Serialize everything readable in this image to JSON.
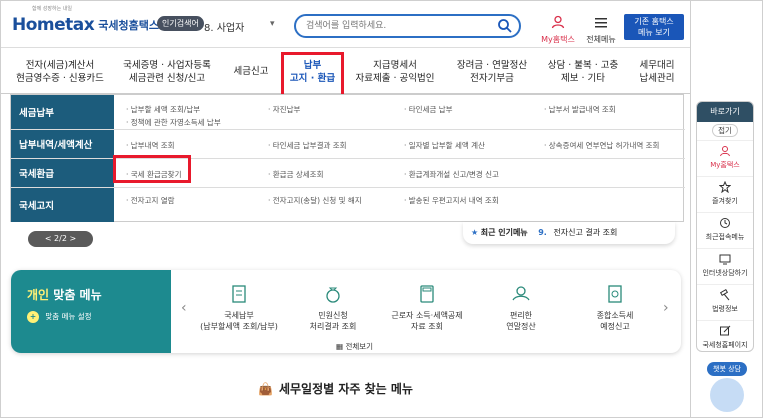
{
  "header": {
    "logo_text": "Hometax",
    "logo_ko": "국세청홈택스",
    "logo_tag": "함께 성장하는 내일",
    "hot_badge": "인기검색어",
    "hot_item": "8. 사업자",
    "search_placeholder": "검색어를 입력하세요.",
    "my_home": "My홈택스",
    "all_menu": "전체메뉴",
    "basic_btn": "기존 홈택스\n메뉴 보기"
  },
  "gnb": {
    "items": [
      "전자(세금)계산서\n현금영수증 · 신용카드",
      "국세증명 · 사업자등록\n세금관련 신청/신고",
      "세금신고",
      "납부\n고지 · 환급",
      "지급명세서\n자료제출 · 공익법인",
      "장려금 · 연말정산\n전자기부금",
      "상담 · 불복 · 고충\n제보 · 기타",
      "세무대리\n납세관리"
    ]
  },
  "dropdown": {
    "rows": [
      {
        "head": "세금납부",
        "links": [
          "납부할 세액 조회/납부",
          "자진납부",
          "타인세금 납부",
          "납부서 발급내역 조회",
          "정책에 관한 자영소득세 납부"
        ]
      },
      {
        "head": "납부내역/세액계산",
        "links": [
          "납부내역 조회",
          "타인세금 납부결과 조회",
          "일자별 납부할 세액 계산",
          "상속증여세 연부연납 허가내역 조회"
        ]
      },
      {
        "head": "국세환급",
        "links": [
          "국세 환급금찾기",
          "환급금 상세조회",
          "환급계좌개설 신고/변경 신고"
        ]
      },
      {
        "head": "국세고지",
        "links": [
          "전자고지 열람",
          "전자고지(송달) 신청 및 해지",
          "발송된 우편고지서 내역 조회"
        ]
      }
    ]
  },
  "banner_ctrl": "< 2/2 >",
  "recent": {
    "title": "최근 인기메뉴",
    "num": "9.",
    "item": "전자신고 결과 조회"
  },
  "personal": {
    "title_a": "개인",
    "title_b": "맞춤 메뉴",
    "setting": "맞춤 메뉴 설정",
    "items": [
      "국세납부\n(납부할세액 조회/납부)",
      "민원신청\n처리결과 조회",
      "근로자 소득·세액공제\n자료 조회",
      "편리한\n연말정산",
      "종합소득세\n예정신고"
    ],
    "view_all": "전체보기"
  },
  "schedule_title": "세무일정별 자주 찾는 메뉴",
  "quick": {
    "title": "바로가기",
    "collapse": "접기",
    "items": [
      "My홈택스",
      "즐겨찾기",
      "최근접속메뉴",
      "인터넷상담하기",
      "법령정보",
      "국세청홈페이지"
    ]
  },
  "chatbot": "챗봇 상담",
  "colors": {
    "primary": "#1a56b8",
    "teal": "#1d8a8f",
    "dd_head": "#1c5c7c",
    "highlight": "#e8192c"
  }
}
